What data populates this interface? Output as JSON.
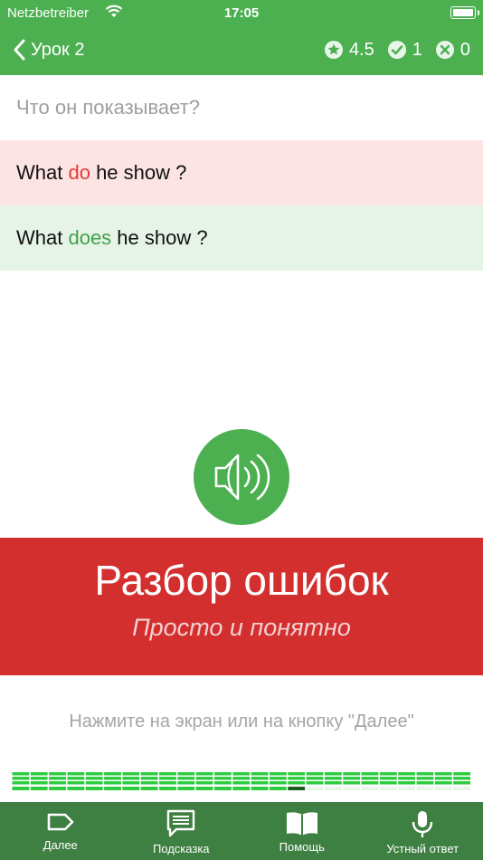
{
  "status_bar": {
    "carrier": "Netzbetreiber",
    "time": "17:05"
  },
  "nav": {
    "back_label": "Урок 2",
    "rating": "4.5",
    "correct": "1",
    "wrong": "0"
  },
  "question": "Что он показывает?",
  "wrong_answer": {
    "before": "What ",
    "highlight": "do",
    "after": " he show ?"
  },
  "correct_answer": {
    "before": "What ",
    "highlight": "does",
    "after": " he show ?"
  },
  "banner": {
    "title": "Разбор ошибок",
    "subtitle": "Просто и понятно"
  },
  "hint": "Нажмите на экран или на кнопку \"Далее\"",
  "progress": {
    "columns": 25,
    "rows": 3,
    "completed": 15,
    "current": 16,
    "accent": "#2ecc40"
  },
  "tabs": [
    {
      "label": "Далее",
      "icon": "tag-icon"
    },
    {
      "label": "Подсказка",
      "icon": "speech-bubble-icon"
    },
    {
      "label": "Помощь",
      "icon": "book-icon"
    },
    {
      "label": "Устный ответ",
      "icon": "microphone-icon"
    }
  ],
  "colors": {
    "header": "#4caf50",
    "wrong_bg": "#fde4e4",
    "correct_bg": "#e6f4e7",
    "banner": "#d32f2f",
    "tabbar": "#3e7f42"
  }
}
